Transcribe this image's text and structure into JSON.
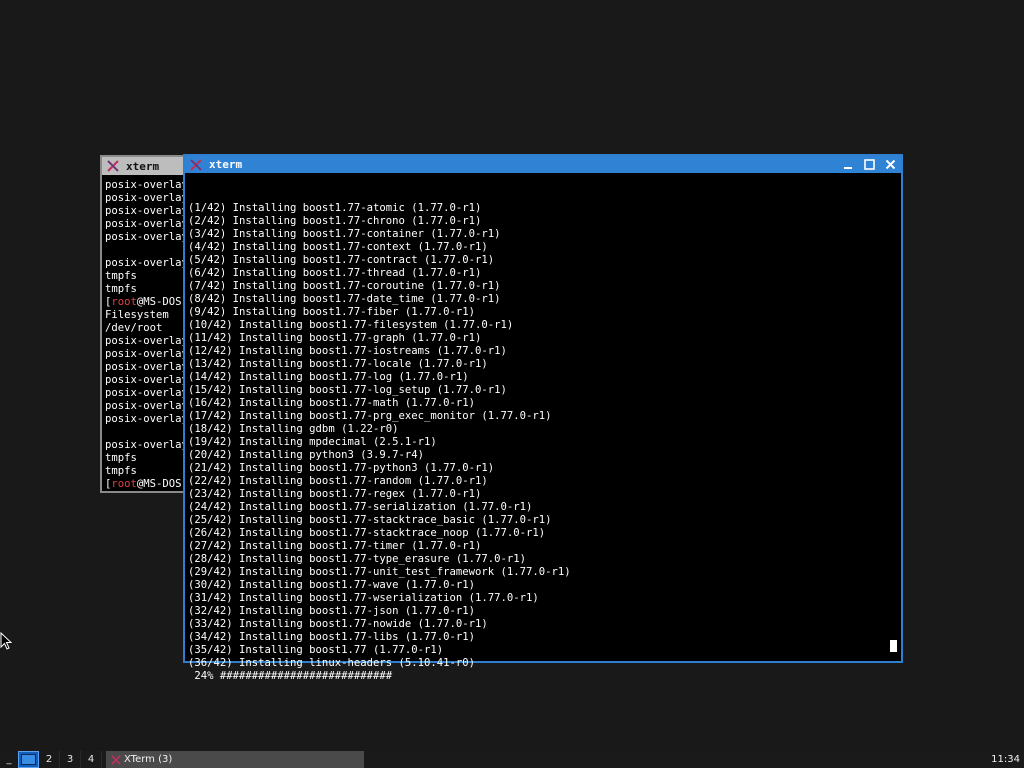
{
  "back_window": {
    "title": "xterm",
    "lines": [
      "posix-overlay",
      "posix-overlay",
      "posix-overlay",
      "posix-overlay",
      "posix-overlay",
      "",
      "posix-overlay",
      "tmpfs",
      "tmpfs",
      "[root@MS-DOS",
      "Filesystem",
      "/dev/root",
      "posix-overlay",
      "posix-overlay",
      "posix-overlay",
      "posix-overlay",
      "posix-overlay",
      "posix-overlay",
      "posix-overlay",
      "",
      "posix-overlay",
      "tmpfs",
      "tmpfs",
      "[root@MS-DOS"
    ]
  },
  "front_window": {
    "title": "xterm",
    "buttons": {
      "minimize": "minimize-icon",
      "maximize": "maximize-icon",
      "close": "close-icon"
    },
    "lines": [
      "(1/42) Installing boost1.77-atomic (1.77.0-r1)",
      "(2/42) Installing boost1.77-chrono (1.77.0-r1)",
      "(3/42) Installing boost1.77-container (1.77.0-r1)",
      "(4/42) Installing boost1.77-context (1.77.0-r1)",
      "(5/42) Installing boost1.77-contract (1.77.0-r1)",
      "(6/42) Installing boost1.77-thread (1.77.0-r1)",
      "(7/42) Installing boost1.77-coroutine (1.77.0-r1)",
      "(8/42) Installing boost1.77-date_time (1.77.0-r1)",
      "(9/42) Installing boost1.77-fiber (1.77.0-r1)",
      "(10/42) Installing boost1.77-filesystem (1.77.0-r1)",
      "(11/42) Installing boost1.77-graph (1.77.0-r1)",
      "(12/42) Installing boost1.77-iostreams (1.77.0-r1)",
      "(13/42) Installing boost1.77-locale (1.77.0-r1)",
      "(14/42) Installing boost1.77-log (1.77.0-r1)",
      "(15/42) Installing boost1.77-log_setup (1.77.0-r1)",
      "(16/42) Installing boost1.77-math (1.77.0-r1)",
      "(17/42) Installing boost1.77-prg_exec_monitor (1.77.0-r1)",
      "(18/42) Installing gdbm (1.22-r0)",
      "(19/42) Installing mpdecimal (2.5.1-r1)",
      "(20/42) Installing python3 (3.9.7-r4)",
      "(21/42) Installing boost1.77-python3 (1.77.0-r1)",
      "(22/42) Installing boost1.77-random (1.77.0-r1)",
      "(23/42) Installing boost1.77-regex (1.77.0-r1)",
      "(24/42) Installing boost1.77-serialization (1.77.0-r1)",
      "(25/42) Installing boost1.77-stacktrace_basic (1.77.0-r1)",
      "(26/42) Installing boost1.77-stacktrace_noop (1.77.0-r1)",
      "(27/42) Installing boost1.77-timer (1.77.0-r1)",
      "(28/42) Installing boost1.77-type_erasure (1.77.0-r1)",
      "(29/42) Installing boost1.77-unit_test_framework (1.77.0-r1)",
      "(30/42) Installing boost1.77-wave (1.77.0-r1)",
      "(31/42) Installing boost1.77-wserialization (1.77.0-r1)",
      "(32/42) Installing boost1.77-json (1.77.0-r1)",
      "(33/42) Installing boost1.77-nowide (1.77.0-r1)",
      "(34/42) Installing boost1.77-libs (1.77.0-r1)",
      "(35/42) Installing boost1.77 (1.77.0-r1)",
      "(36/42) Installing linux-headers (5.10.41-r0)",
      " 24% ###########################"
    ]
  },
  "taskbar": {
    "menu_label": "_",
    "workspaces": [
      "1",
      "2",
      "3",
      "4"
    ],
    "active_workspace": "1",
    "task_label": "XTerm (3)",
    "clock": "11:34"
  },
  "colors": {
    "desktop_bg": "#191919",
    "active_title": "#2f82d4",
    "inactive_title": "#bdbdbd",
    "root_red": "#e04040",
    "workspace_active": "#0f5fbf"
  }
}
